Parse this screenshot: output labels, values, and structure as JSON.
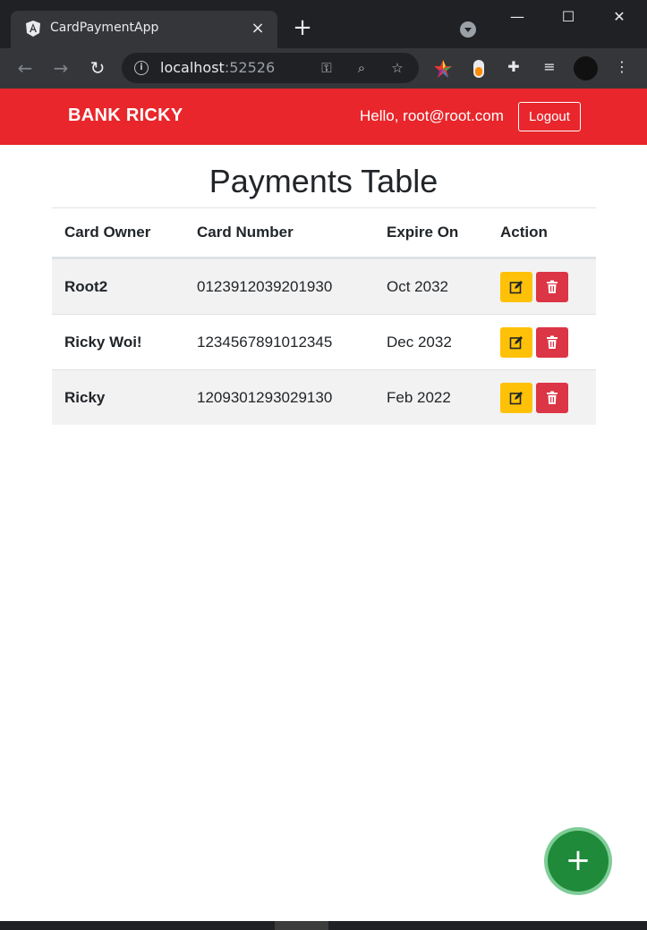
{
  "browser": {
    "tab_title": "CardPaymentApp",
    "url_host": "localhost",
    "url_port": ":52526",
    "new_tab": "+",
    "close_tab": "×"
  },
  "navbar": {
    "brand": "BANK RICKY",
    "greeting": "Hello, root@root.com",
    "logout_label": "Logout"
  },
  "page": {
    "title": "Payments Table"
  },
  "table": {
    "headers": [
      "Card Owner",
      "Card Number",
      "Expire On",
      "Action"
    ],
    "rows": [
      {
        "owner": "Root2",
        "number": "0123912039201930",
        "expire": "Oct 2032"
      },
      {
        "owner": "Ricky Woi!",
        "number": "1234567891012345",
        "expire": "Dec 2032"
      },
      {
        "owner": "Ricky",
        "number": "1209301293029130",
        "expire": "Feb 2022"
      }
    ]
  },
  "fab": {
    "label": "+"
  },
  "colors": {
    "navbar": "#e8262b",
    "edit_button": "#ffc107",
    "delete_button": "#dc3545",
    "fab": "#1e8a3a"
  }
}
